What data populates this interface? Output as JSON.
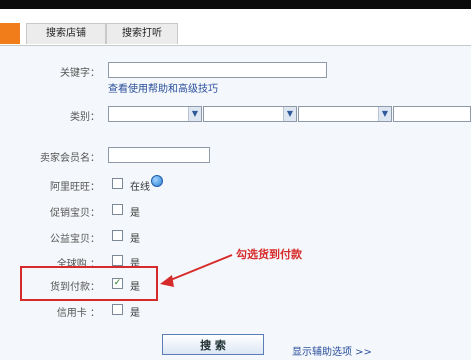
{
  "tabs": [
    {
      "label": ""
    },
    {
      "label": "搜索店铺"
    },
    {
      "label": "搜索打听"
    }
  ],
  "keyword": {
    "label": "关键字：",
    "value": "",
    "help_link": "查看使用帮助和高级技巧"
  },
  "category": {
    "label": "类别：",
    "selects": [
      "",
      "",
      "",
      ""
    ]
  },
  "seller": {
    "label": "卖家会员名：",
    "value": ""
  },
  "aliwangwang": {
    "label": "阿里旺旺：",
    "option": "在线",
    "checked": false
  },
  "promo": {
    "label": "促销宝贝：",
    "option": "是",
    "checked": false
  },
  "charity": {
    "label": "公益宝贝：",
    "option": "是",
    "checked": false
  },
  "global": {
    "label": "全球购 ：",
    "option": "是",
    "checked": false
  },
  "cod": {
    "label": "货到付款：",
    "option": "是",
    "checked": true,
    "check_mark": "✓"
  },
  "credit": {
    "label": "信用卡 ：",
    "option": "是",
    "checked": false
  },
  "annotation": {
    "text": "勾选货到付款",
    "color": "#d62b2b"
  },
  "search_button": {
    "label": "搜 索"
  },
  "more_options": {
    "label": "显示辅助选项 >>"
  },
  "colors": {
    "accent_tab": "#f07d19",
    "form_bg": "#f4f7fb",
    "link": "#2a4f9c"
  }
}
